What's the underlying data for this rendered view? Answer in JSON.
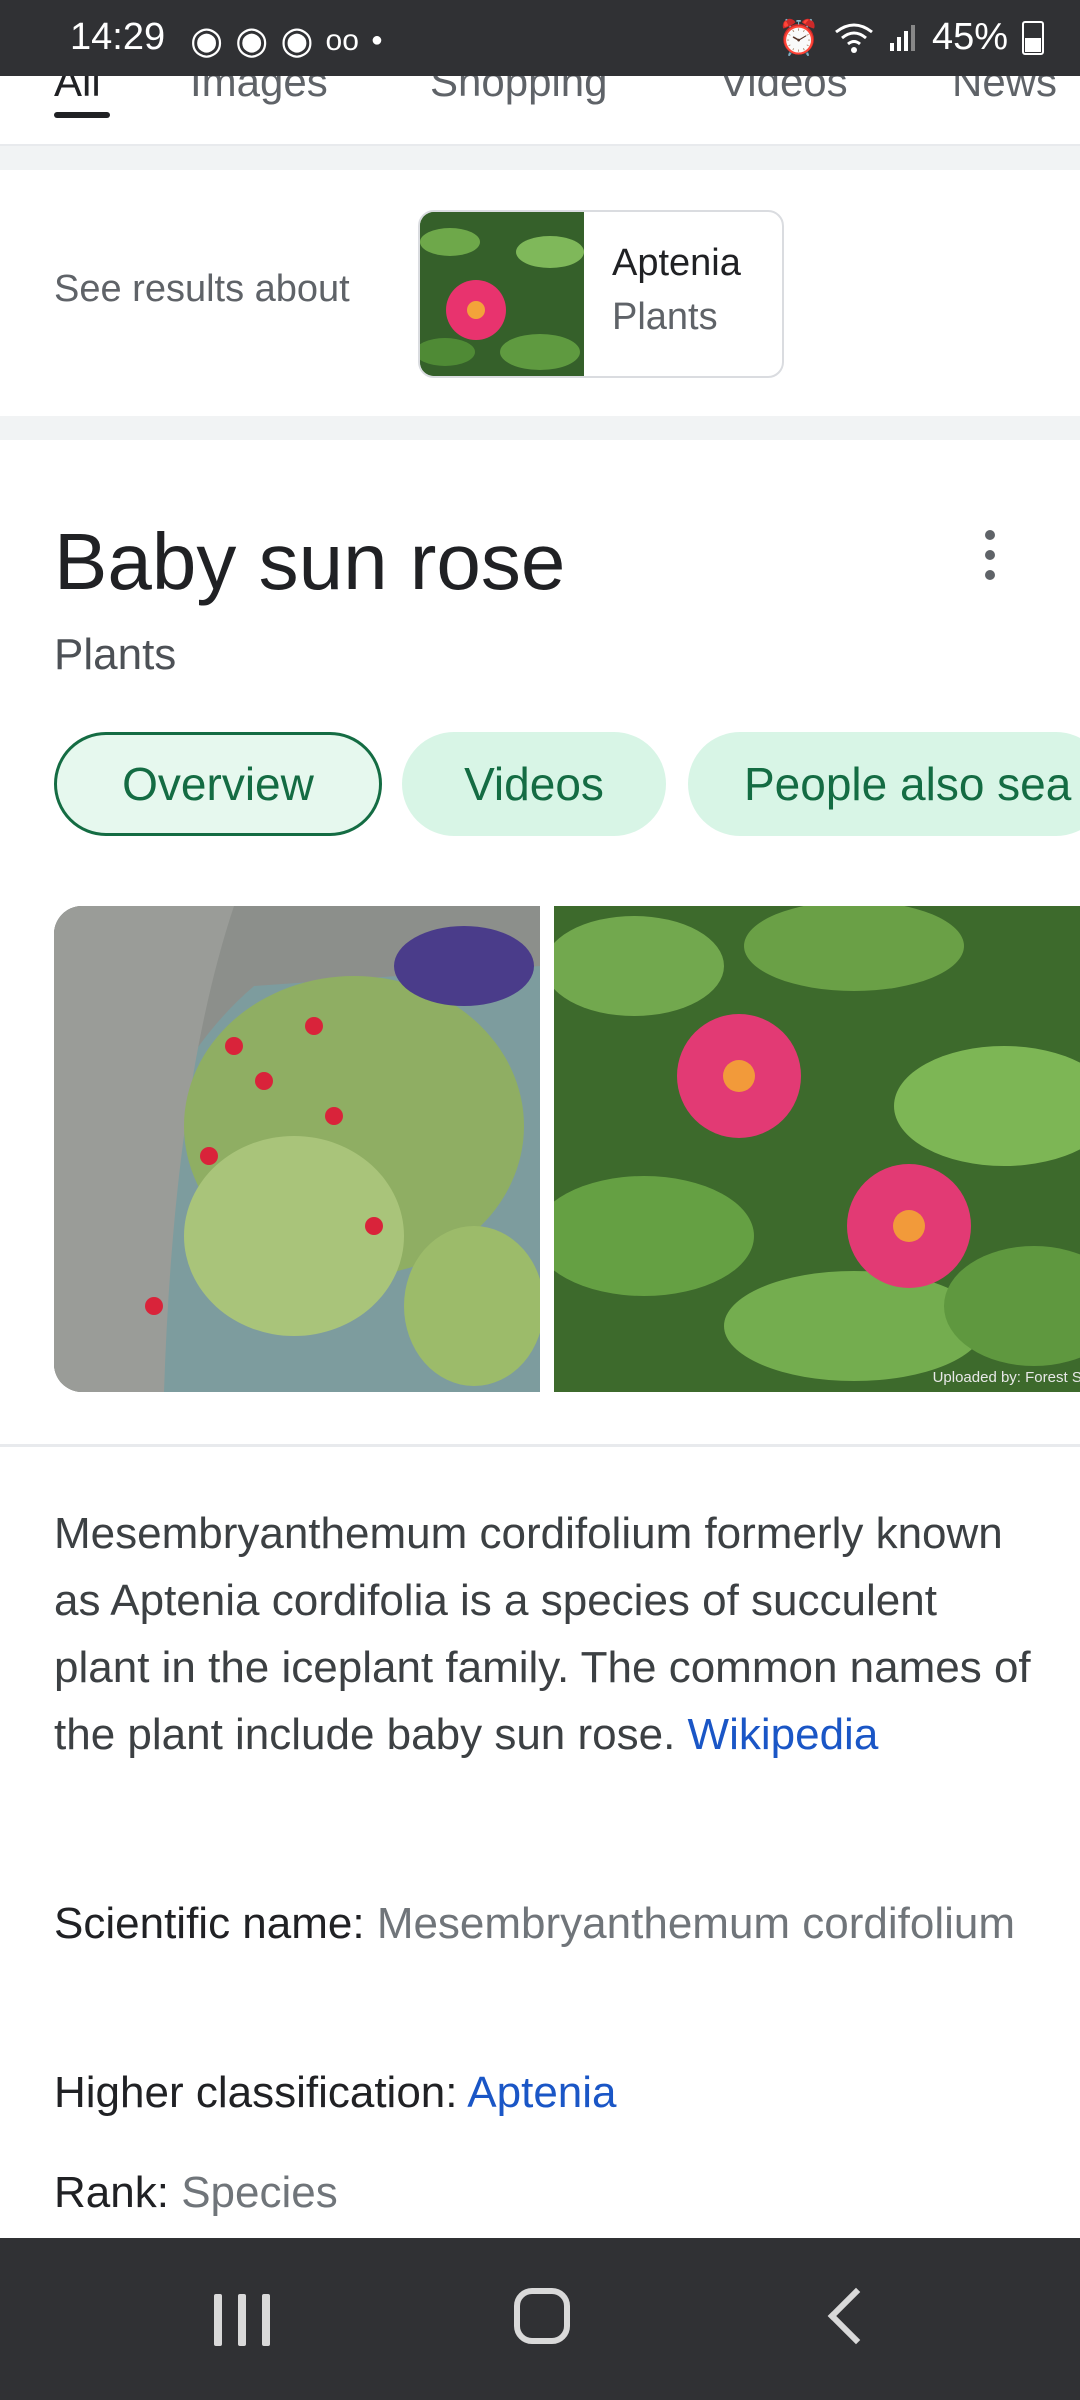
{
  "status_bar": {
    "time": "14:29",
    "battery": "45%",
    "icons": [
      "alarm-icon",
      "wifi-icon",
      "signal-icon",
      "battery-icon"
    ]
  },
  "search_tabs": [
    {
      "label": "All",
      "active": true
    },
    {
      "label": "Images",
      "active": false
    },
    {
      "label": "Shopping",
      "active": false
    },
    {
      "label": "Videos",
      "active": false
    },
    {
      "label": "News",
      "active": false
    }
  ],
  "see_results": {
    "label": "See results about",
    "entity_name": "Aptenia",
    "entity_type": "Plants"
  },
  "knowledge_panel": {
    "title": "Baby sun rose",
    "subtitle": "Plants",
    "chips": [
      "Overview",
      "Videos",
      "People also sea"
    ],
    "photo_caption": "Uploaded by: Forest St",
    "description": "Mesembryanthemum cordifolium formerly known as Aptenia cordifolia is a species of succulent plant in the iceplant family. The common names of the plant include baby sun rose.",
    "source_link": "Wikipedia",
    "facts": [
      {
        "label": "Scientific name:",
        "value": "Mesembryanthemum cordifolium"
      },
      {
        "label": "Higher classification:",
        "value": "Aptenia"
      },
      {
        "label": "Rank:",
        "value": "Species"
      }
    ]
  },
  "colors": {
    "chip_bg": "#d8f5e6",
    "chip_text": "#146c43",
    "link": "#1a56c6",
    "system_bar": "#303134"
  }
}
